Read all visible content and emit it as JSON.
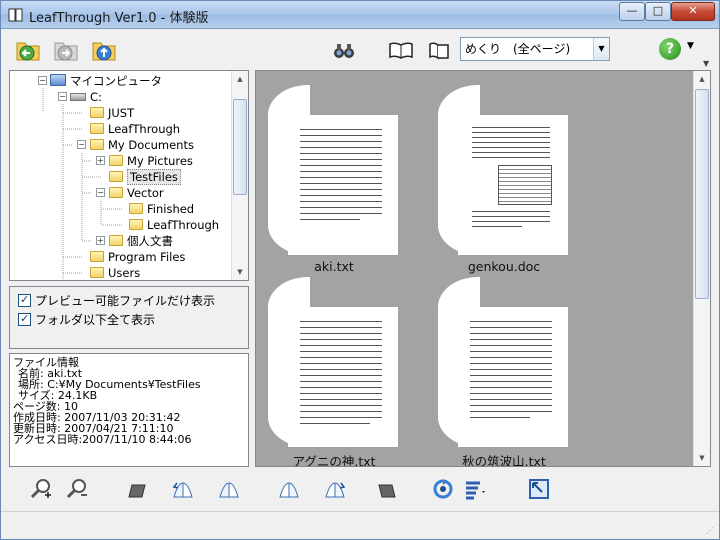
{
  "window": {
    "title": "LeafThrough Ver1.0 - 体験版"
  },
  "titlebar": {
    "min": "—",
    "max": "□",
    "close": "✕"
  },
  "toolbar": {
    "view_mode": "めくり　(全ページ)",
    "help_label": "?"
  },
  "tree": {
    "items": [
      {
        "label": "マイコンピュータ",
        "kind": "pc",
        "level": 0,
        "expander": "−"
      },
      {
        "label": "C:",
        "kind": "drive",
        "level": 1,
        "expander": "−"
      },
      {
        "label": "JUST",
        "kind": "folder",
        "level": 2
      },
      {
        "label": "LeafThrough",
        "kind": "folder",
        "level": 2
      },
      {
        "label": "My Documents",
        "kind": "folder",
        "level": 2,
        "expander": "−"
      },
      {
        "label": "My Pictures",
        "kind": "folder",
        "level": 3,
        "expander": "+"
      },
      {
        "label": "TestFiles",
        "kind": "folder",
        "level": 3,
        "selected": true
      },
      {
        "label": "Vector",
        "kind": "folder",
        "level": 3,
        "expander": "−"
      },
      {
        "label": "Finished",
        "kind": "folder",
        "level": 4
      },
      {
        "label": "LeafThrough",
        "kind": "folder",
        "level": 4
      },
      {
        "label": "個人文書",
        "kind": "folder",
        "level": 3,
        "expander": "+"
      },
      {
        "label": "Program Files",
        "kind": "folder",
        "level": 2
      },
      {
        "label": "Users",
        "kind": "folder",
        "level": 2
      }
    ]
  },
  "options": {
    "preview_only": "プレビュー可能ファイルだけ表示",
    "show_subfolders": "フォルダ以下全て表示"
  },
  "file_info": {
    "heading": "ファイル情報",
    "name": "名前: aki.txt",
    "location": "場所: C:¥My Documents¥TestFiles",
    "size": "サイズ: 24.1KB",
    "pages": "ページ数: 10",
    "created": "作成日時: 2007/11/03 20:31:42",
    "modified": "更新日時: 2007/04/21 7:11:10",
    "accessed": "アクセス日時:2007/11/10 8:44:06"
  },
  "thumbnails": [
    {
      "name": "aki.txt"
    },
    {
      "name": "genkou.doc"
    },
    {
      "name": "アグニの神.txt"
    },
    {
      "name": "秋の筑波山.txt"
    }
  ],
  "colors": {
    "accent": "#2a8f1d",
    "panel_bg": "#a3a3a3"
  }
}
